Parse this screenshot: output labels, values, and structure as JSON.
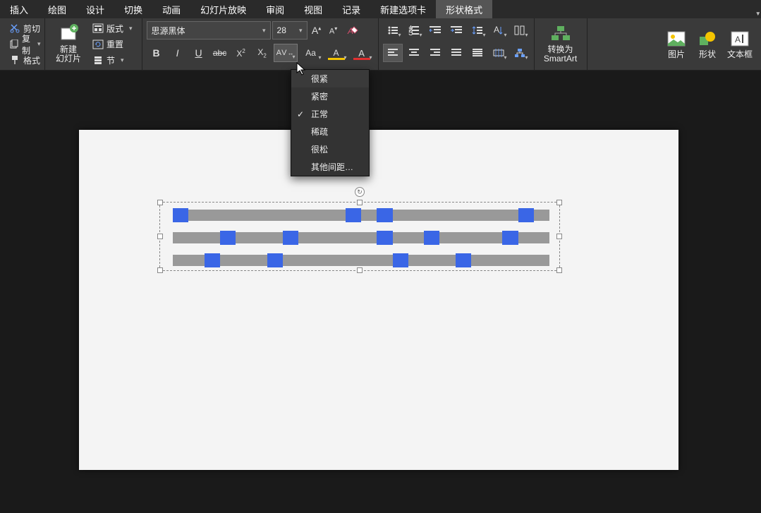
{
  "menu": {
    "tabs": [
      "插入",
      "绘图",
      "设计",
      "切换",
      "动画",
      "幻灯片放映",
      "审阅",
      "视图",
      "记录",
      "新建选项卡",
      "形状格式"
    ],
    "active": 10
  },
  "ribbon": {
    "clipboard": {
      "cut": "剪切",
      "copy": "复制",
      "format": "格式"
    },
    "slides": {
      "new_slide": "新建\n幻灯片",
      "layout": "版式",
      "reset": "重置",
      "section": "节"
    },
    "font": {
      "name": "思源黑体",
      "size": "28",
      "increase": "A",
      "decrease": "A",
      "clear": "A",
      "bold": "B",
      "italic": "I",
      "underline": "U",
      "strike": "abc",
      "super": "X",
      "sub": "X",
      "spacing": "AV",
      "case": "Aa",
      "highlight_color": "#f4c400",
      "font_color": "#e03030"
    },
    "paragraph": {
      "bullets": "•",
      "numbers": "1.",
      "indent_dec": "⇤",
      "indent_inc": "⇥",
      "linespace": "↕",
      "textdir": "⇅",
      "columns": "▥",
      "align_l": "≡",
      "align_c": "≡",
      "align_r": "≡",
      "align_j": "≡",
      "dist": "≣",
      "align_obj": "⊟",
      "smartart": "⌬"
    },
    "smartart": {
      "convert": "转换为\nSmartArt"
    },
    "insert": {
      "picture": "图片",
      "shapes": "形状",
      "textbox": "文本框"
    }
  },
  "spacing_menu": {
    "items": [
      "很紧",
      "紧密",
      "正常",
      "稀疏",
      "很松",
      "其他间距…"
    ],
    "selected": 2
  },
  "text_lines": {
    "line1_pattern": "bggg gggg gggb gbgg gggg ggbg",
    "line2_pattern": "gggb gggb gggg gbgg bggg gbgg",
    "line3_pattern": "ggbg ggbg gggg ggbg ggbg gggg"
  }
}
